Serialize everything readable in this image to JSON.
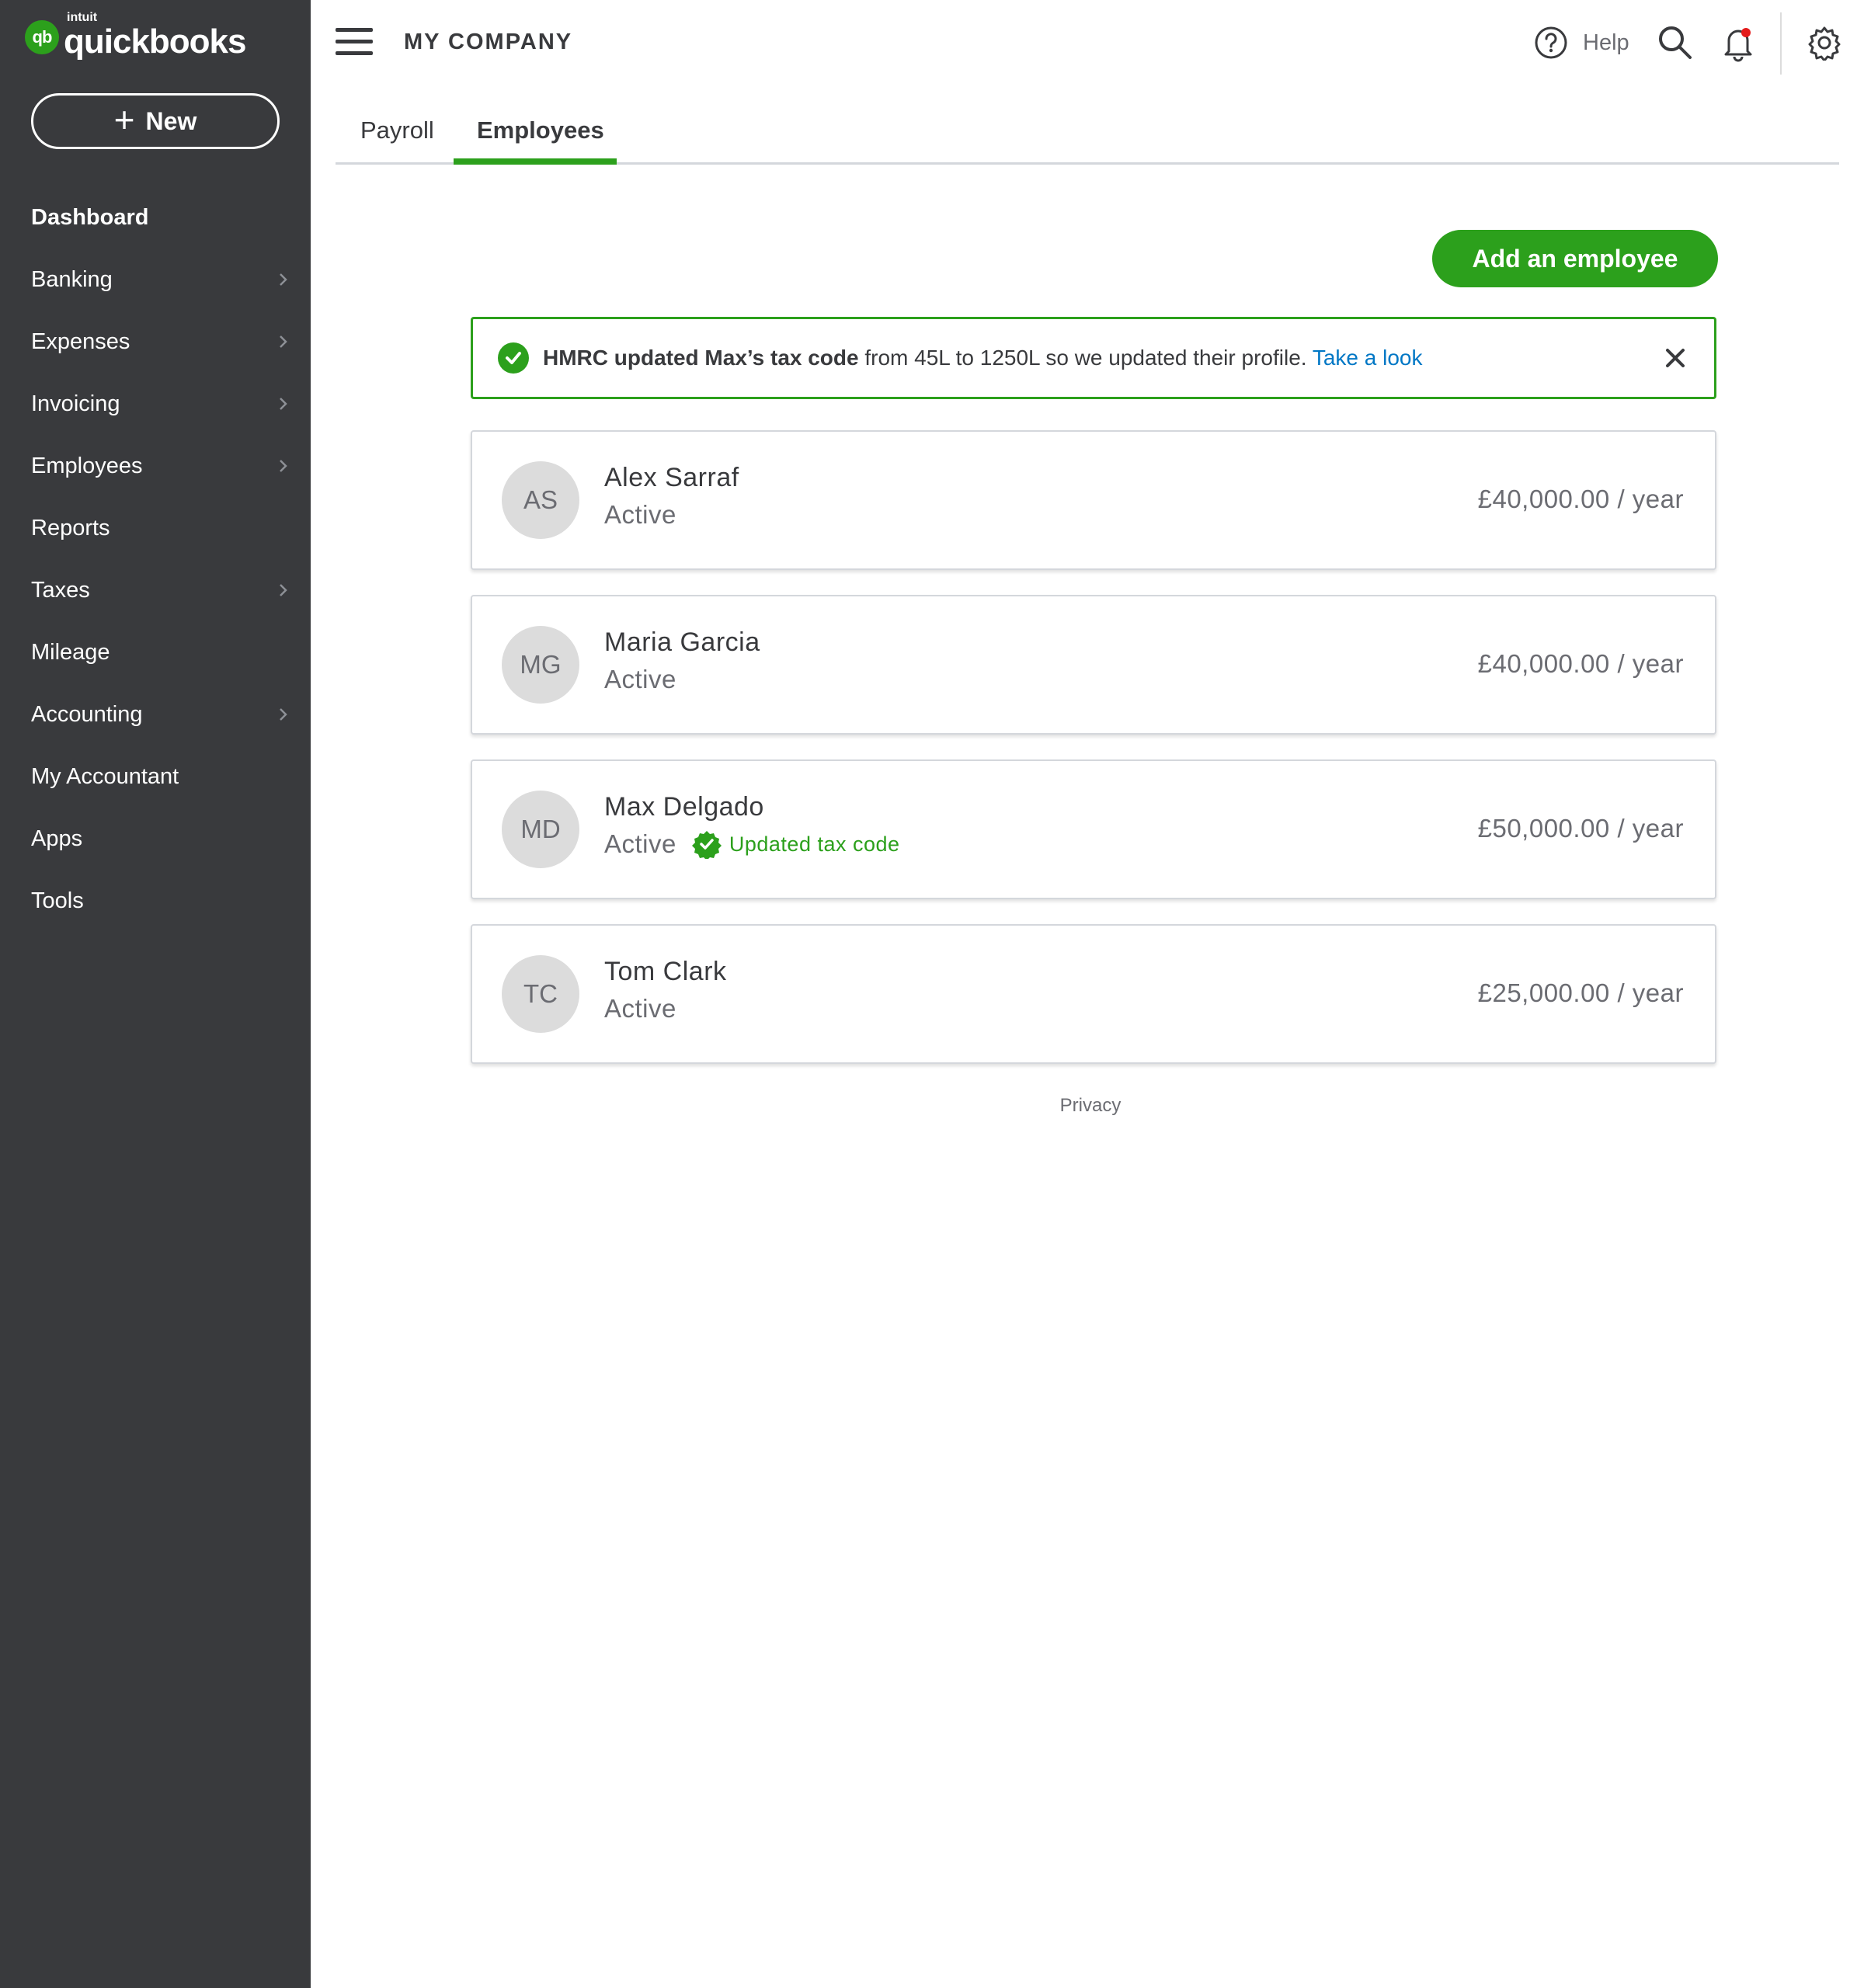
{
  "brand": {
    "badge": "qb",
    "intuit": "intuit",
    "name": "quickbooks",
    "accent": "#2ca01c",
    "sidebar_bg": "#393a3d",
    "link_color": "#0077c5"
  },
  "sidebar": {
    "new_label": "New",
    "items": [
      {
        "label": "Dashboard",
        "has_chevron": false
      },
      {
        "label": "Banking",
        "has_chevron": true
      },
      {
        "label": "Expenses",
        "has_chevron": true
      },
      {
        "label": "Invoicing",
        "has_chevron": true
      },
      {
        "label": "Employees",
        "has_chevron": true
      },
      {
        "label": "Reports",
        "has_chevron": false
      },
      {
        "label": "Taxes",
        "has_chevron": true
      },
      {
        "label": "Mileage",
        "has_chevron": false
      },
      {
        "label": "Accounting",
        "has_chevron": true
      },
      {
        "label": "My Accountant",
        "has_chevron": false
      },
      {
        "label": "Apps",
        "has_chevron": false
      },
      {
        "label": "Tools",
        "has_chevron": false
      }
    ]
  },
  "header": {
    "company": "MY COMPANY",
    "help_label": "Help",
    "icons": [
      "menu-icon",
      "help-icon",
      "search-icon",
      "bell-icon",
      "gear-icon"
    ]
  },
  "tabs": [
    {
      "label": "Payroll",
      "active": false
    },
    {
      "label": "Employees",
      "active": true
    }
  ],
  "add_employee_label": "Add an employee",
  "notice": {
    "bold": "HMRC updated Max’s tax code",
    "text": " from 45L to 1250L so we updated their profile. ",
    "link": "Take a look"
  },
  "employees": [
    {
      "initials": "AS",
      "name": "Alex Sarraf",
      "status": "Active",
      "badge": "",
      "salary": "£40,000.00 / year"
    },
    {
      "initials": "MG",
      "name": "Maria Garcia",
      "status": "Active",
      "badge": "",
      "salary": "£40,000.00 / year"
    },
    {
      "initials": "MD",
      "name": "Max Delgado",
      "status": "Active",
      "badge": "Updated tax code",
      "salary": "£50,000.00 / year"
    },
    {
      "initials": "TC",
      "name": "Tom Clark",
      "status": "Active",
      "badge": "",
      "salary": "£25,000.00 / year"
    }
  ],
  "footer": {
    "privacy": "Privacy"
  }
}
